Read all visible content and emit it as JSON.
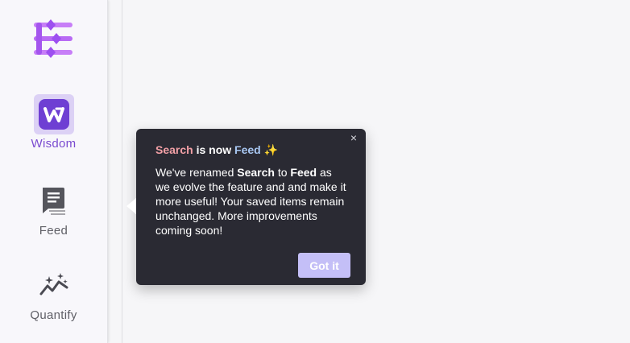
{
  "sidebar": {
    "logo_icon": "hub-logo-icon",
    "items": [
      {
        "label": "Wisdom",
        "icon": "wisdom-w-icon",
        "active": true
      },
      {
        "label": "Feed",
        "icon": "feed-document-icon",
        "active": false
      },
      {
        "label": "Quantify",
        "icon": "quantify-chart-sparkle-icon",
        "active": false
      }
    ]
  },
  "popover": {
    "title_part1": "Search",
    "title_part2": " is now ",
    "title_part3": "Feed",
    "title_sparkle": "✨",
    "body_1": "We've renamed ",
    "body_bold_search": "Search",
    "body_2": " to ",
    "body_bold_feed": "Feed",
    "body_3": " as we evolve the feature and and make it more useful! Your saved items remain unchanged. More improvements coming soon!",
    "close_symbol": "×",
    "button_label": "Got it"
  },
  "colors": {
    "accent": "#7a4bd0",
    "popover_bg": "#2a2a33",
    "title_search": "#f2a0a6",
    "title_feed": "#a8c7f2",
    "button_bg": "#c4bff7"
  }
}
